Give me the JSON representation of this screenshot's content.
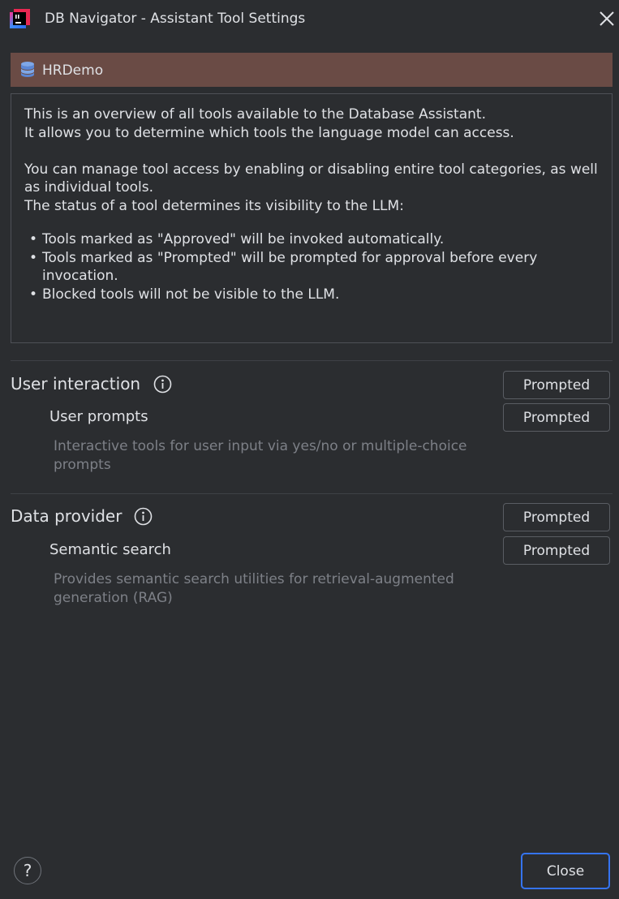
{
  "window": {
    "title": "DB Navigator - Assistant Tool Settings",
    "app_icon": "intellij-app-icon",
    "close_icon": "close-icon"
  },
  "connection": {
    "name": "HRDemo",
    "icon": "database-icon",
    "bar_color": "#6a4b45"
  },
  "overview": {
    "line1": "This is an overview of all tools available to the Database Assistant.",
    "line2": "It allows you to determine which tools the language model can access.",
    "line3": "You can manage tool access by enabling or disabling entire tool categories, as well as individual tools.",
    "line4": "The status of a tool determines its visibility to the LLM:",
    "bullets": [
      "Tools marked as \"Approved\" will be invoked automatically.",
      "Tools marked as \"Prompted\" will be prompted for approval before every invocation.",
      "Blocked tools will not be visible to the LLM."
    ]
  },
  "categories": [
    {
      "name": "User interaction",
      "status": "Prompted",
      "tools": [
        {
          "name": "User prompts",
          "status": "Prompted",
          "description": "Interactive tools for user input via yes/no or multiple-choice prompts"
        }
      ]
    },
    {
      "name": "Data provider",
      "status": "Prompted",
      "tools": [
        {
          "name": "Semantic search",
          "status": "Prompted",
          "description": "Provides semantic search utilities for retrieval-augmented generation (RAG)"
        }
      ]
    }
  ],
  "footer": {
    "help_label": "?",
    "close_label": "Close"
  },
  "colors": {
    "background": "#2b2d30",
    "accent": "#3574f0",
    "muted_text": "#7d8087"
  }
}
